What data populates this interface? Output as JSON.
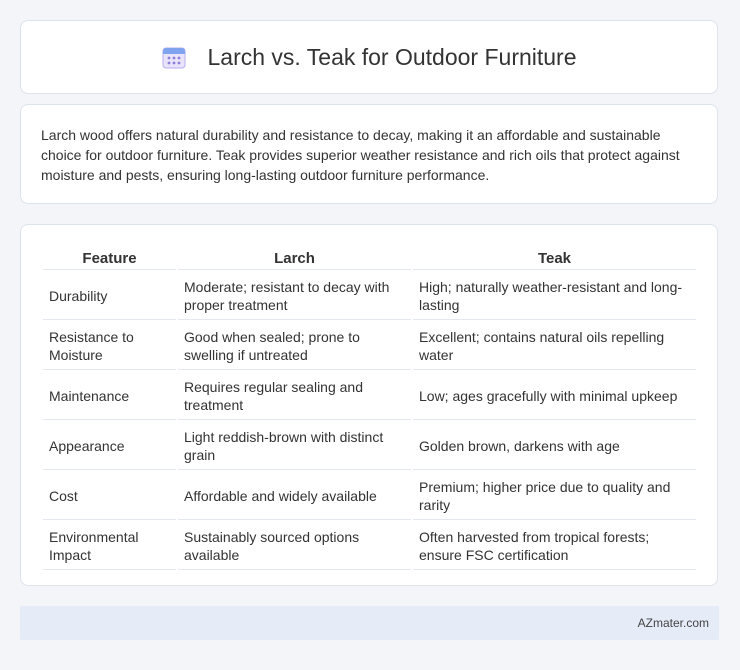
{
  "header": {
    "title": "Larch vs. Teak for Outdoor Furniture",
    "icon": "calendar-icon"
  },
  "description": {
    "text": "Larch wood offers natural durability and resistance to decay, making it an affordable and sustainable choice for outdoor furniture. Teak provides superior weather resistance and rich oils that protect against moisture and pests, ensuring long-lasting outdoor furniture performance."
  },
  "table": {
    "headers": [
      "Feature",
      "Larch",
      "Teak"
    ],
    "rows": [
      [
        "Durability",
        "Moderate; resistant to decay with proper treatment",
        "High; naturally weather-resistant and long-lasting"
      ],
      [
        "Resistance to Moisture",
        "Good when sealed; prone to swelling if untreated",
        "Excellent; contains natural oils repelling water"
      ],
      [
        "Maintenance",
        "Requires regular sealing and treatment",
        "Low; ages gracefully with minimal upkeep"
      ],
      [
        "Appearance",
        "Light reddish-brown with distinct grain",
        "Golden brown, darkens with age"
      ],
      [
        "Cost",
        "Affordable and widely available",
        "Premium; higher price due to quality and rarity"
      ],
      [
        "Environmental Impact",
        "Sustainably sourced options available",
        "Often harvested from tropical forests; ensure FSC certification"
      ]
    ]
  },
  "footer": {
    "text": "AZmater.com"
  },
  "colors": {
    "background": "#f3f5f9",
    "card": "#ffffff",
    "footer_bg": "#e6ecf7",
    "icon_accent": "#7b6fd6"
  }
}
